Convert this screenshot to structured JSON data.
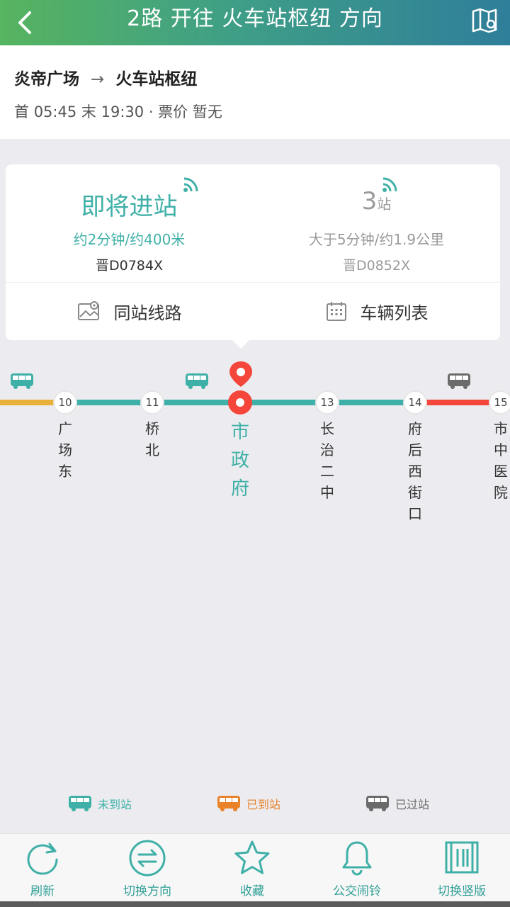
{
  "header": {
    "title": "2路 开往 火车站枢纽 方向"
  },
  "route": {
    "from": "炎帝广场",
    "arrow": "→",
    "to": "火车站枢纽",
    "first_label": "首",
    "first_time": "05:45",
    "last_label": "末",
    "last_time": "19:30",
    "fare_label": "· 票价",
    "fare_value": "暂无"
  },
  "buses": [
    {
      "status": "即将进站",
      "detail": "约2分钟/约400米",
      "plate": "晋D0784X"
    },
    {
      "stops_count": "3",
      "stops_unit": "站",
      "detail": "大于5分钟/约1.9公里",
      "plate": "晋D0852X"
    }
  ],
  "actions": {
    "same_station": "同站线路",
    "vehicle_list": "车辆列表"
  },
  "stations": [
    {
      "num": "10",
      "name": "广场东"
    },
    {
      "num": "11",
      "name": "桥北"
    },
    {
      "num": "",
      "name": "市政府",
      "current": true
    },
    {
      "num": "13",
      "name": "长治二中"
    },
    {
      "num": "14",
      "name": "府后西街口"
    },
    {
      "num": "15",
      "name": "市中医院"
    }
  ],
  "legend": {
    "not_arrived": "未到站",
    "arrived": "已到站",
    "passed": "已过站"
  },
  "colors": {
    "teal": "#3fb0a7",
    "orange": "#e8832a",
    "gray": "#6b6b6b",
    "red": "#f4463a",
    "yellow": "#e9b13a"
  },
  "toolbar": {
    "refresh": "刷新",
    "switch_direction": "切换方向",
    "favorite": "收藏",
    "alarm": "公交闹铃",
    "switch_layout": "切换竖版"
  }
}
